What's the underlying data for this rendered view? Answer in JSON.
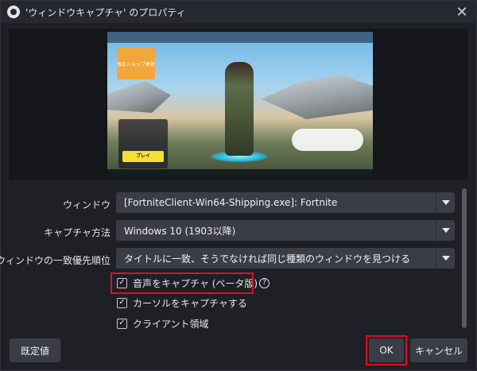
{
  "window": {
    "title": "'ウィンドウキャプチャ' のプロパティ",
    "close_glyph": "✕"
  },
  "preview": {
    "shop_label": "毎日ショップ更新",
    "play_label": "プレイ"
  },
  "fields": {
    "window_label": "ウィンドウ",
    "window_value": "[FortniteClient-Win64-Shipping.exe]: Fortnite",
    "capture_method_label": "キャプチャ方法",
    "capture_method_value": "Windows 10 (1903以降)",
    "priority_label": "ウィンドウの一致優先順位",
    "priority_value": "タイトルに一致、そうでなければ同じ種類のウィンドウを見つける"
  },
  "checkboxes": {
    "capture_audio": {
      "label": "音声をキャプチャ (ベータ版)",
      "checked": true,
      "help_glyph": "?"
    },
    "capture_cursor": {
      "label": "カーソルをキャプチャする",
      "checked": true
    },
    "client_area": {
      "label": "クライアント領域",
      "checked": true
    }
  },
  "check_glyph": "✓",
  "buttons": {
    "defaults": "既定値",
    "ok": "OK",
    "cancel": "キャンセル"
  },
  "colors": {
    "highlight": "#e01020",
    "background": "#1e2026",
    "control": "#3a3d46"
  }
}
